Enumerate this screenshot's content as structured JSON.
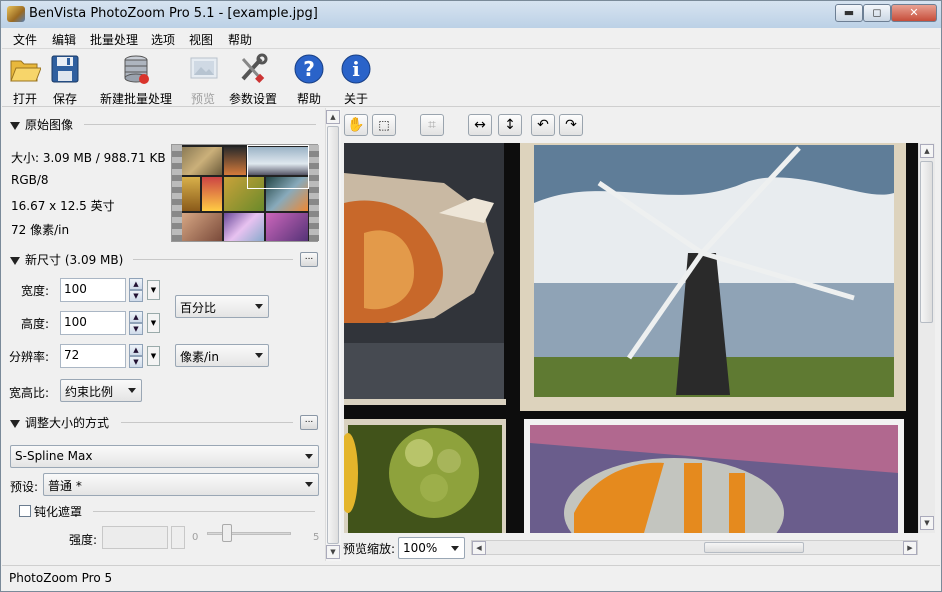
{
  "window": {
    "title": "BenVista PhotoZoom Pro 5.1 - [example.jpg]",
    "min_label": "▬",
    "max_label": "◻",
    "close_label": "✕"
  },
  "menu": [
    "文件",
    "编辑",
    "批量处理",
    "选项",
    "视图",
    "帮助"
  ],
  "toolbar": {
    "open": "打开",
    "save": "保存",
    "new_batch": "新建批量处理",
    "preview": "预览",
    "settings": "参数设置",
    "help": "帮助",
    "about": "关于"
  },
  "original": {
    "header": "原始图像",
    "size": "大小: 3.09 MB / 988.71 KB",
    "mode": "RGB/8",
    "dims": "16.67 x 12.5 英寸",
    "res": "72 像素/in"
  },
  "newsize": {
    "header": "新尺寸 (3.09 MB)",
    "dots": "...",
    "width_label": "宽度:",
    "width_value": "100",
    "height_label": "高度:",
    "height_value": "100",
    "res_label": "分辨率:",
    "res_value": "72",
    "unit_dim": "百分比",
    "unit_res": "像素/in",
    "aspect_label": "宽高比:",
    "aspect_value": "约束比例"
  },
  "resize_method": {
    "header": "调整大小的方式",
    "dots": "...",
    "method": "S-Spline Max",
    "preset_label": "预设:",
    "preset_value": "普通 *",
    "unsharp_label": "钝化遮罩",
    "strength_label": "强度:",
    "slider_min": "0",
    "slider_max": "5"
  },
  "preview_bar": {
    "zoom_label": "预览缩放:",
    "zoom_value": "100%"
  },
  "status": {
    "text": "PhotoZoom Pro 5"
  }
}
